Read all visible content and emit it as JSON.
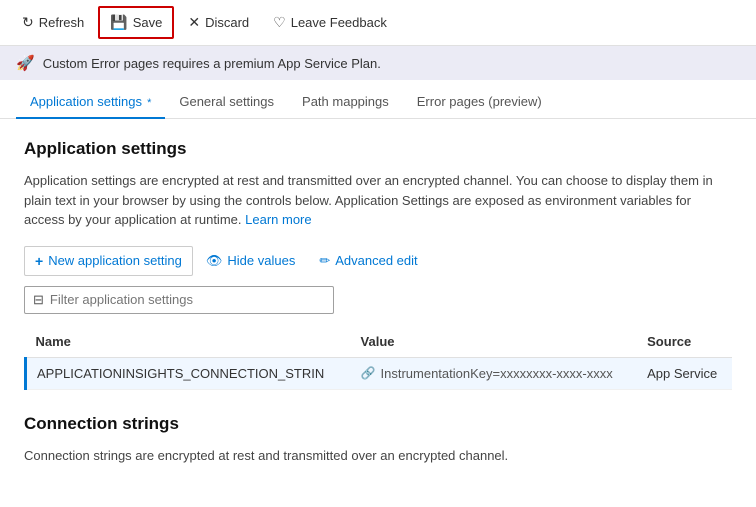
{
  "toolbar": {
    "refresh_label": "Refresh",
    "save_label": "Save",
    "discard_label": "Discard",
    "feedback_label": "Leave Feedback"
  },
  "banner": {
    "text": "Custom Error pages requires a premium App Service Plan."
  },
  "tabs": [
    {
      "label": "Application settings",
      "id": "app-settings",
      "active": true,
      "asterisk": true
    },
    {
      "label": "General settings",
      "id": "general-settings",
      "active": false
    },
    {
      "label": "Path mappings",
      "id": "path-mappings",
      "active": false
    },
    {
      "label": "Error pages (preview)",
      "id": "error-pages",
      "active": false
    }
  ],
  "section": {
    "title": "Application settings",
    "description": "Application settings are encrypted at rest and transmitted over an encrypted channel. You can choose to display them in plain text in your browser by using the controls below. Application Settings are exposed as environment variables for access by your application at runtime.",
    "learn_more": "Learn more"
  },
  "actions": {
    "new_setting": "New application setting",
    "hide_values": "Hide values",
    "advanced_edit": "Advanced edit"
  },
  "filter": {
    "placeholder": "Filter application settings"
  },
  "table": {
    "columns": [
      "Name",
      "Value",
      "Source"
    ],
    "rows": [
      {
        "name": "APPLICATIONINSIGHTS_CONNECTION_STRIN",
        "value": "InstrumentationKey=xxxxxxxx-xxxx-xxxx",
        "source": "App Service"
      }
    ]
  },
  "connection_strings": {
    "title": "Connection strings",
    "description": "Connection strings are encrypted at rest and transmitted over an encrypted channel."
  }
}
